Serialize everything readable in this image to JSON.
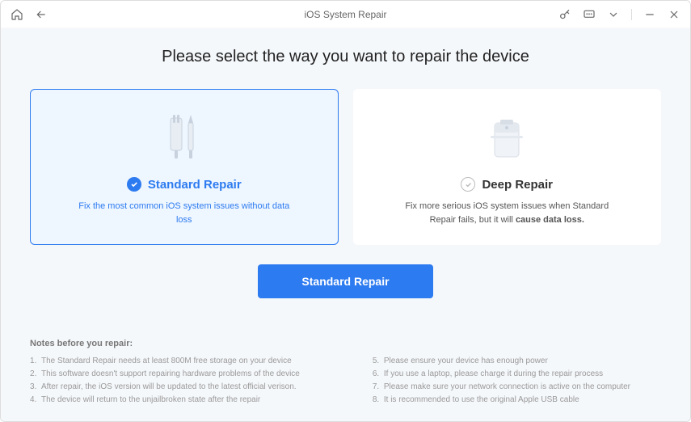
{
  "titlebar": {
    "title": "iOS System Repair"
  },
  "heading": "Please select the way you want to repair the device",
  "cards": {
    "standard": {
      "title": "Standard Repair",
      "description": "Fix the most common iOS system issues without data loss"
    },
    "deep": {
      "title": "Deep Repair",
      "description_part1": "Fix more serious iOS system issues when Standard Repair fails, but it will ",
      "description_emphasis": "cause data loss."
    }
  },
  "action_button": "Standard Repair",
  "notes": {
    "title": "Notes before you repair:",
    "col1": [
      "The Standard Repair needs at least 800M free storage on your device",
      "This software doesn't support repairing hardware problems of the device",
      "After repair, the iOS version will be updated to the latest official verison.",
      "The device will return to the unjailbroken state after the repair"
    ],
    "col2": [
      "Please ensure your device has enough power",
      "If you use a laptop, please charge it during the repair process",
      "Please make sure your network connection is active on the computer",
      "It is recommended to use the original Apple USB cable"
    ]
  }
}
